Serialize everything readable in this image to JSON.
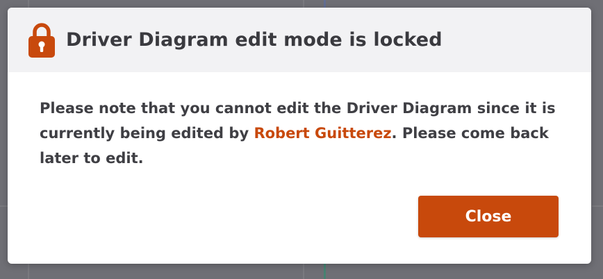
{
  "dialog": {
    "title": "Driver Diagram edit mode is locked",
    "message_before": "Please note that you cannot edit the Driver Diagram since it is currently being edited by ",
    "locked_by": "Robert Guitterez",
    "message_after": ". Please come back later to edit.",
    "close_label": "Close",
    "icon": "lock-icon"
  },
  "colors": {
    "accent": "#c8490c",
    "title_text": "#3a3a3f",
    "header_bg": "#f2f2f4",
    "overlay": "#6f6f75"
  }
}
